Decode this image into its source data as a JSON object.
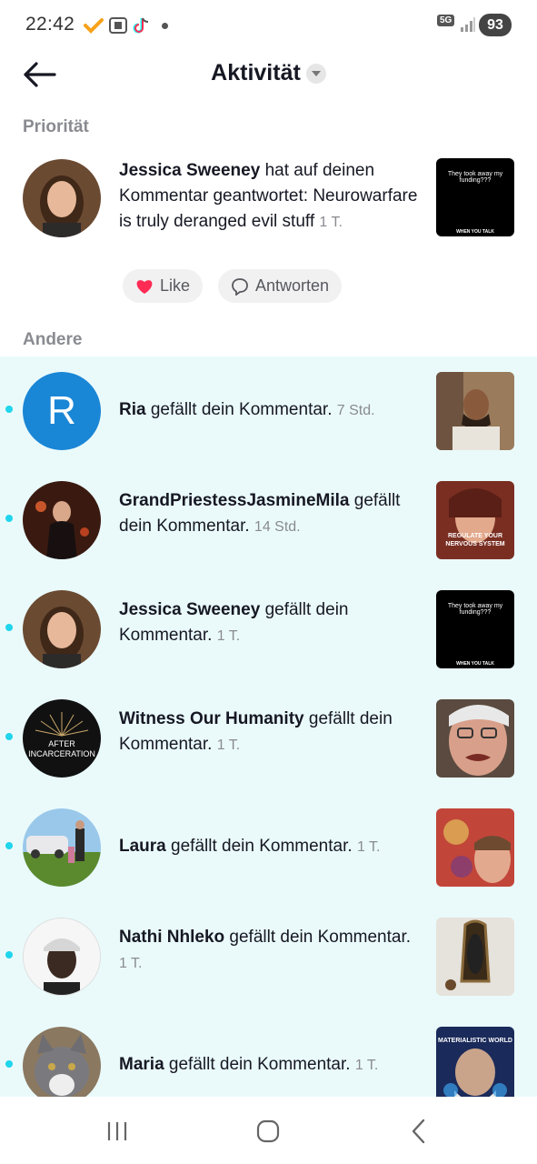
{
  "status": {
    "time": "22:42",
    "network": "5G",
    "battery": "93"
  },
  "header": {
    "title": "Aktivität"
  },
  "sections": {
    "priority": "Priorität",
    "others": "Andere"
  },
  "priority_item": {
    "user": "Jessica Sweeney",
    "text": "hat auf deinen Kommentar geantwortet: Neurowarfare is truly deranged evil stuff",
    "time": "1 T.",
    "thumb_caption": "They took away my funding???",
    "thumb_footer": "WHEN YOU TALK",
    "like_label": "Like",
    "reply_label": "Antworten"
  },
  "items": [
    {
      "user": "Ria",
      "text": "gefällt dein Kommentar.",
      "time": "7 Std.",
      "avatar_letter": "R"
    },
    {
      "user": "GrandPriestessJasmineMila",
      "text": "gefällt dein Kommentar.",
      "time": "14 Std.",
      "thumb_caption": "REGULATE YOUR NERVOUS SYSTEM"
    },
    {
      "user": "Jessica Sweeney",
      "text": "gefällt dein Kommentar.",
      "time": "1 T.",
      "thumb_caption": "They took away my funding???",
      "thumb_footer": "WHEN YOU TALK"
    },
    {
      "user": "Witness Our Humanity",
      "text": "gefällt dein Kommentar.",
      "time": "1 T.",
      "avatar_caption": "AFTER INCARCERATION"
    },
    {
      "user": "Laura",
      "text": "gefällt dein Kommentar.",
      "time": "1 T."
    },
    {
      "user": "Nathi Nhleko",
      "text": "gefällt dein Kommentar.",
      "time": "1 T."
    },
    {
      "user": "Maria",
      "text": "gefällt dein Kommentar.",
      "time": "1 T.",
      "thumb_caption": "MATERIALISTIC WORLD"
    }
  ],
  "colors": {
    "accent": "#20d5ec",
    "unread_bg": "#eafafb",
    "like": "#fe2c55",
    "avatar_blue": "#1a86d6"
  }
}
